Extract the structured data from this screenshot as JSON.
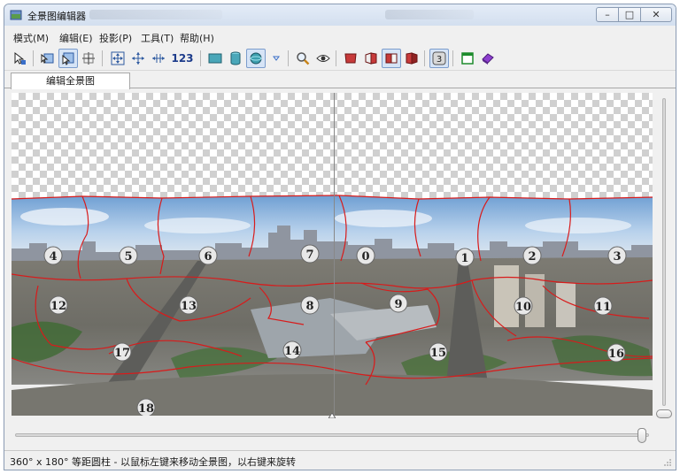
{
  "window": {
    "title": "全景图编辑器",
    "buttons": {
      "minimize": "–",
      "maximize": "□",
      "close": "✕"
    }
  },
  "menu": [
    {
      "label": "模式(M)"
    },
    {
      "label": "编辑(E)"
    },
    {
      "label": "投影(P)"
    },
    {
      "label": "工具(T)"
    },
    {
      "label": "帮助(H)"
    }
  ],
  "toolbar": {
    "numbers_label": "123",
    "tools": [
      "select-tool-icon",
      "image-pointer-icon",
      "image-select-icon",
      "crosshair-icon",
      "fit-arrows-icon",
      "move-center-icon",
      "align-horizontal-icon",
      "numbers-text",
      "flat-projection-icon",
      "cylinder-projection-icon",
      "sphere-projection-icon",
      "dropdown-arrow-icon",
      "zoom-icon",
      "preview-eye-icon",
      "face-red-icon",
      "face-left-icon",
      "face-split-icon",
      "face-right-icon",
      "number-3-icon",
      "window-green-icon",
      "eraser-icon"
    ],
    "badge_label": "3"
  },
  "tabs": [
    {
      "label": "编辑全景图"
    }
  ],
  "panorama": {
    "labels": [
      "0",
      "1",
      "2",
      "3",
      "4",
      "5",
      "6",
      "7",
      "8",
      "9",
      "10",
      "11",
      "12",
      "13",
      "14",
      "15",
      "16",
      "17",
      "18"
    ]
  },
  "status": {
    "text": "360° x 180° 等距圆柱 - 以鼠标左键来移动全景图，以右键来旋转"
  },
  "colors": {
    "seam": "#d81b1b",
    "sky": "#9fc3e6",
    "ground": "#6f6a5c",
    "accent": "#7b9ccc"
  }
}
